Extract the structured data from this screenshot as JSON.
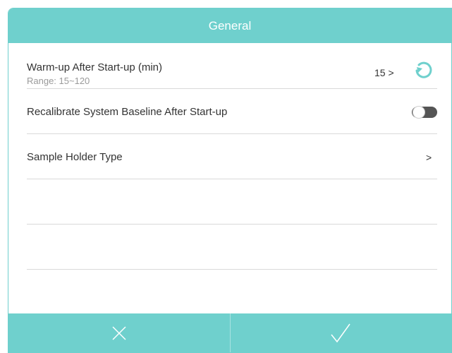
{
  "header": {
    "title": "General"
  },
  "settings": {
    "warmup": {
      "label": "Warm-up After Start-up (min)",
      "range": "Range: 15~120",
      "value": "15 >"
    },
    "recalibrate": {
      "label": "Recalibrate System Baseline After Start-up",
      "enabled": false
    },
    "sample_holder": {
      "label": "Sample Holder Type",
      "arrow": ">"
    }
  },
  "icons": {
    "reset": "refresh-icon",
    "cancel": "close-icon",
    "confirm": "check-icon"
  },
  "colors": {
    "accent": "#6fd0cd",
    "toggle_off": "#555555"
  }
}
